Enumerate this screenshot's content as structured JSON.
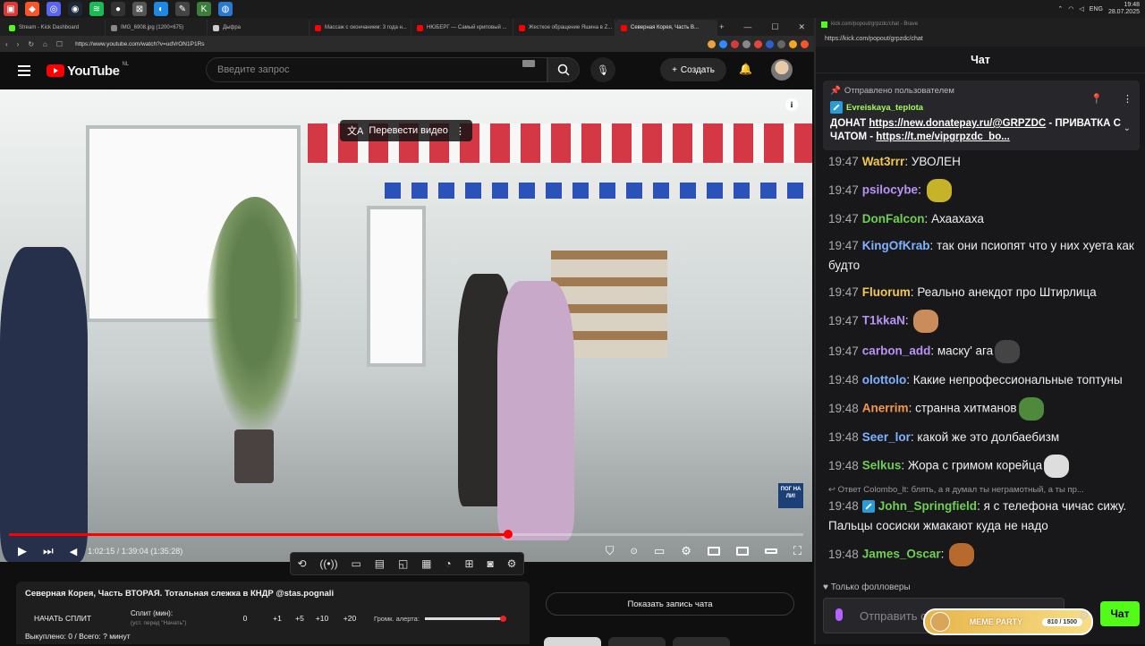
{
  "taskbar": {
    "lang": "ENG",
    "time": "19:48",
    "date": "28.07.2025"
  },
  "browser": {
    "tabs": [
      {
        "label": "Stream - Kick Dashboard",
        "color": "#53fc18"
      },
      {
        "label": "IMG_6908.jpg (1200×675)",
        "color": "#888888"
      },
      {
        "label": "Дыфра",
        "color": "#cccccc"
      },
      {
        "label": "Массаж с окончанием: 3 года н...",
        "color": "#ff0000"
      },
      {
        "label": "НЮБЕРГ — Самый криповый ...",
        "color": "#ff0000"
      },
      {
        "label": "Жесткое обращение Яшина в Z...",
        "color": "#ff0000"
      },
      {
        "label": "Северная Корея, Часть В...",
        "color": "#ff0000"
      }
    ],
    "url": "https://www.youtube.com/watch?v=udVrON1P1Rs"
  },
  "youtube": {
    "logo_text": "YouTube",
    "country_code": "NL",
    "search_placeholder": "Введите запрос",
    "create_label": "Создать",
    "translate_label": "Перевести видео",
    "time_display": "1:02:15 / 1:39:04 (1:35:28)",
    "progress_fraction": 0.628,
    "watermark": "ПОГ НА ЛИ!",
    "video_title": "Северная Корея, Часть ВТОРАЯ. Тотальная слежка в КНДР @stas.pognali",
    "split_start": "НАЧАТЬ СПЛИТ",
    "split_label": "Сплит (мин):",
    "split_hint": "(уст. перед \"Начать\")",
    "split_values": [
      "0",
      "+1",
      "+5",
      "+10",
      "+20"
    ],
    "alert_volume_label": "Громк. алерта:",
    "bought_total": "Выкуплено: 0 / Всего: ? минут",
    "show_chat_label": "Показать запись чата"
  },
  "chat": {
    "url": "https://kick.com/popout/grpzdc/chat",
    "window_title": "kick.com/popout/grpzdc/chat - Brave",
    "header": "Чат",
    "pinned": {
      "label": "Отправлено пользователем",
      "user": "Evreiskaya_teplota",
      "text1": "ДОНАТ ",
      "link1": "https://new.donatepay.ru/@GRPZDC",
      "text2": " - ПРИВАТКА С ЧАТОМ - ",
      "link2": "https://t.me/vipgrpzdc_bo..."
    },
    "messages": [
      {
        "time": "19:47",
        "user": "Wat3rrr",
        "color": "#f2c94c",
        "text": "УВОЛЕН",
        "emote": ""
      },
      {
        "time": "19:47",
        "user": "psilocybe",
        "color": "#b794f4",
        "text": "",
        "emote": "#c7b32a"
      },
      {
        "time": "19:47",
        "user": "DonFalcon",
        "color": "#6fcf52",
        "text": "Ахаахаха",
        "emote": ""
      },
      {
        "time": "19:47",
        "user": "KingOfKrab",
        "color": "#7fb3ff",
        "text": "так они псиопят что у них хуета как будто",
        "emote": ""
      },
      {
        "time": "19:47",
        "user": "Fluorum",
        "color": "#f2c94c",
        "text": "Реально анекдот про Штирлица",
        "emote": ""
      },
      {
        "time": "19:47",
        "user": "T1kkaN",
        "color": "#b794f4",
        "text": "",
        "emote": "#c98c5a"
      },
      {
        "time": "19:47",
        "user": "carbon_add",
        "color": "#b794f4",
        "text": "маску' ага",
        "emote": "#444444"
      },
      {
        "time": "19:48",
        "user": "olottolo",
        "color": "#7fb3ff",
        "text": "Какие непрофессиональные топтуны",
        "emote": ""
      },
      {
        "time": "19:48",
        "user": "Anerrim",
        "color": "#f2994a",
        "text": "странна хитманов",
        "emote": "#4f8a3c"
      },
      {
        "time": "19:48",
        "user": "Seer_lor",
        "color": "#7fb3ff",
        "text": "какой же это долбаебизм",
        "emote": ""
      },
      {
        "time": "19:48",
        "user": "Selkus",
        "color": "#6fcf52",
        "text": "Жора с гримом корейца",
        "emote": "#dddddd"
      }
    ],
    "reply_note": "Ответ Colombo_lt: блять, а я думал ты неграмотный, а ты пр...",
    "reply_message": {
      "time": "19:48",
      "user": "John_Springfield",
      "color": "#6fcf52",
      "text": "я с телефона чичас сижу. Пальцы сосиски жмакают куда не надо"
    },
    "last_message": {
      "time": "19:48",
      "user": "James_Oscar",
      "color": "#6fcf52",
      "text": "",
      "emote": "#b86a2c"
    },
    "followers_only": "Только фолловеры",
    "input_placeholder": "Отправить сообщение",
    "meme_party": "MEME PARTY",
    "meme_count": "810 / 1500",
    "send_label": "Чат"
  }
}
